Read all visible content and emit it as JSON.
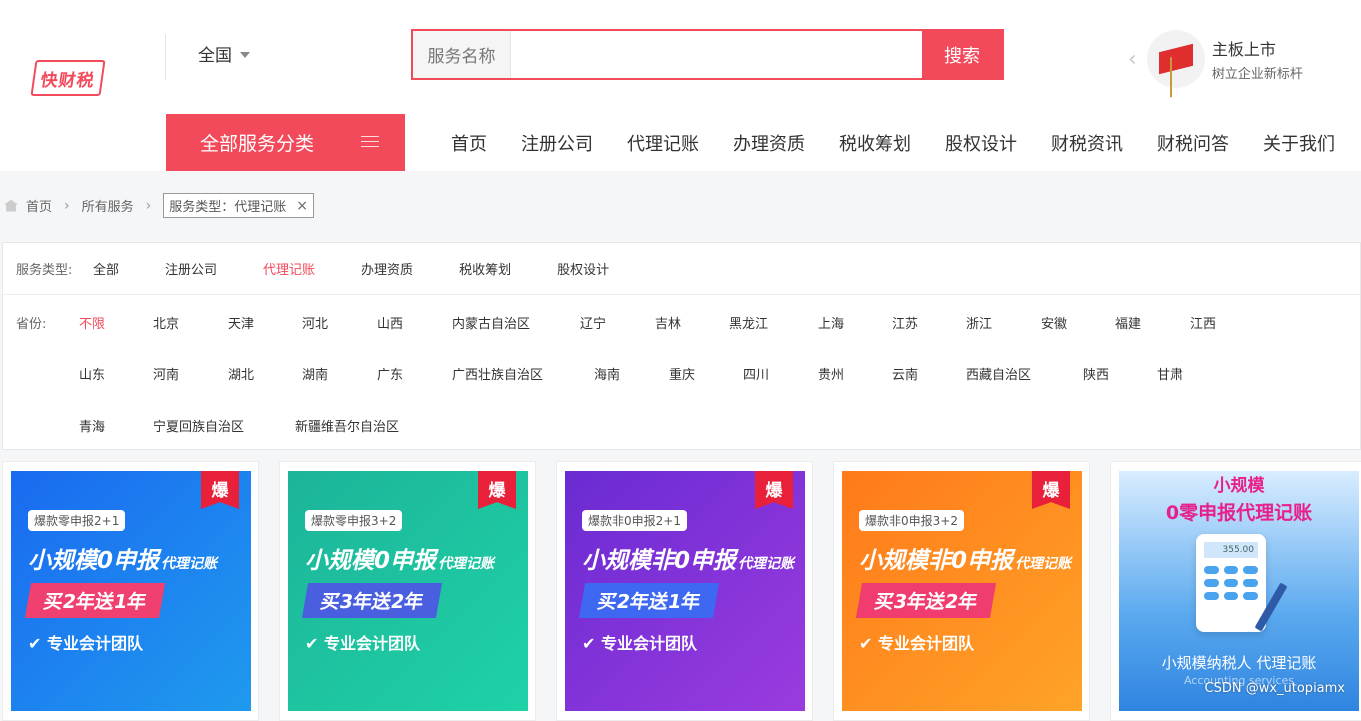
{
  "header": {
    "logo_text": "快财税",
    "city": "全国",
    "search": {
      "label": "服务名称",
      "placeholder": "",
      "value": "",
      "button": "搜索"
    },
    "promo": {
      "title": "主板上市",
      "subtitle": "树立企业新标杆"
    }
  },
  "nav": {
    "category_button": "全部服务分类",
    "links": [
      "首页",
      "注册公司",
      "代理记账",
      "办理资质",
      "税收筹划",
      "股权设计",
      "财税资讯",
      "财税问答",
      "关于我们"
    ]
  },
  "breadcrumb": {
    "home": "首页",
    "all": "所有服务",
    "chip": "服务类型：代理记账"
  },
  "filter": {
    "service_label": "服务类型:",
    "service_options": [
      "全部",
      "注册公司",
      "代理记账",
      "办理资质",
      "税收筹划",
      "股权设计"
    ],
    "service_active": "代理记账",
    "province_label": "省份:",
    "provinces": [
      "不限",
      "北京",
      "天津",
      "河北",
      "山西",
      "内蒙古自治区",
      "辽宁",
      "吉林",
      "黑龙江",
      "上海",
      "江苏",
      "浙江",
      "安徽",
      "福建",
      "江西",
      "山东",
      "河南",
      "湖北",
      "湖南",
      "广东",
      "广西壮族自治区",
      "海南",
      "重庆",
      "四川",
      "贵州",
      "云南",
      "西藏自治区",
      "陕西",
      "甘肃",
      "青海",
      "宁夏回族自治区",
      "新疆维吾尔自治区"
    ],
    "province_active": "不限"
  },
  "cards": [
    {
      "hot": "爆",
      "tag": "爆款零申报2+1",
      "headline": "小规模0申报",
      "headline_suffix": "代理记账",
      "offer": "买2年送1年",
      "team": "专业会计团队"
    },
    {
      "hot": "爆",
      "tag": "爆款零申报3+2",
      "headline": "小规模0申报",
      "headline_suffix": "代理记账",
      "offer": "买3年送2年",
      "team": "专业会计团队"
    },
    {
      "hot": "爆",
      "tag": "爆款非0申报2+1",
      "headline": "小规模非0申报",
      "headline_suffix": "代理记账",
      "offer": "买2年送1年",
      "team": "专业会计团队"
    },
    {
      "hot": "爆",
      "tag": "爆款非0申报3+2",
      "headline": "小规模非0申报",
      "headline_suffix": "代理记账",
      "offer": "买3年送2年",
      "team": "专业会计团队"
    },
    {
      "top1": "小规模",
      "top2": "0零申报代理记账",
      "screen": "355.00",
      "caption": "小规模纳税人 代理记账",
      "sub": "Accounting services"
    }
  ],
  "watermark": "CSDN @wx_utopiamx",
  "colors": {
    "accent": "#f24a5b"
  }
}
